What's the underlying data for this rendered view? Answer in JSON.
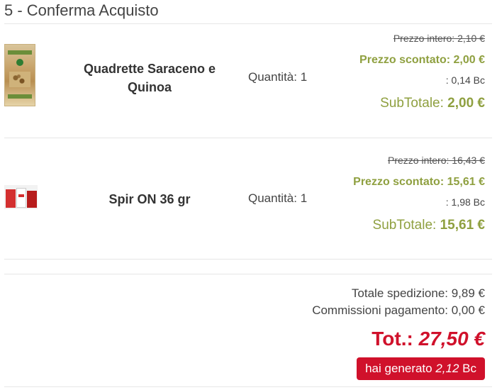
{
  "page": {
    "title": "5 - Conferma Acquisto"
  },
  "items": [
    {
      "name_line1": "Quadrette Saraceno e",
      "name_line2": "Quinoa",
      "quantity_label": "Quantità: 1",
      "price_full": "Prezzo intero: 2,10 €",
      "price_discount_label": "Prezzo scontato: ",
      "price_discount_value": "2,00 €",
      "bc": ": 0,14 Bc",
      "subtotal_label": "SubTotale: ",
      "subtotal_value": "2,00 €"
    },
    {
      "name_line1": "Spir ON 36 gr",
      "name_line2": "",
      "quantity_label": "Quantità: 1",
      "price_full": "Prezzo intero: 16,43 €",
      "price_discount_label": "Prezzo scontato: ",
      "price_discount_value": "15,61 €",
      "bc": ": 1,98 Bc",
      "subtotal_label": "SubTotale: ",
      "subtotal_value": "15,61 €"
    }
  ],
  "summary": {
    "shipping": "Totale spedizione: 9,89 €",
    "fees": "Commissioni pagamento: 0,00 €",
    "total_label": "Tot.: ",
    "total_value": "27,50 €",
    "generated_label": "hai generato ",
    "generated_value": "2,12",
    "generated_unit": " Bc"
  },
  "colors": {
    "accent_green": "#8fa040",
    "accent_red": "#d0112b"
  }
}
